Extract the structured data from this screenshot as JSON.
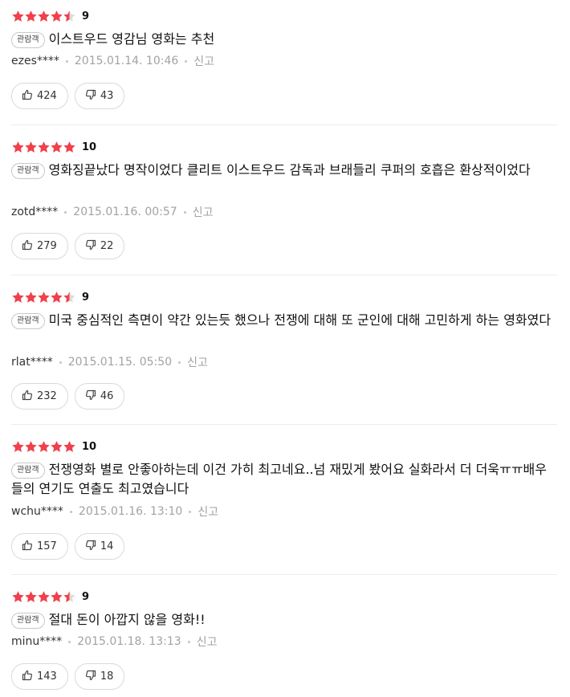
{
  "badge_label": "관람객",
  "report_label": "신고",
  "colors": {
    "star": "#f1404b",
    "star_empty": "#dddddd"
  },
  "icons": {
    "like": "thumbs-up-icon",
    "dislike": "thumbs-down-icon"
  },
  "reviews": [
    {
      "stars": 4.5,
      "score": "9",
      "text": "이스트우드 영감님 영화는 추천",
      "author": "ezes****",
      "date": "2015.01.14. 10:46",
      "likes": "424",
      "dislikes": "43"
    },
    {
      "stars": 5,
      "score": "10",
      "text": "영화징끝났다 명작이었다 클리트 이스트우드 감독과 브래들리 쿠퍼의 호흡은 환상적이었다",
      "author": "zotd****",
      "date": "2015.01.16. 00:57",
      "likes": "279",
      "dislikes": "22"
    },
    {
      "stars": 4.5,
      "score": "9",
      "text": "미국 중심적인 측면이 약간 있는듯 했으나 전쟁에 대해 또 군인에 대해 고민하게 하는 영화였다",
      "author": "rlat****",
      "date": "2015.01.15. 05:50",
      "likes": "232",
      "dislikes": "46"
    },
    {
      "stars": 5,
      "score": "10",
      "text": "전쟁영화 별로 안좋아하는데 이건 가히 최고네요..넘 재밌게 봤어요 실화라서 더 더욱ㅠㅠ배우들의 연기도 연출도 최고였습니다",
      "author": "wchu****",
      "date": "2015.01.16. 13:10",
      "likes": "157",
      "dislikes": "14"
    },
    {
      "stars": 4.5,
      "score": "9",
      "text": "절대 돈이 아깝지 않을 영화!!",
      "author": "minu****",
      "date": "2015.01.18. 13:13",
      "likes": "143",
      "dislikes": "18"
    }
  ]
}
